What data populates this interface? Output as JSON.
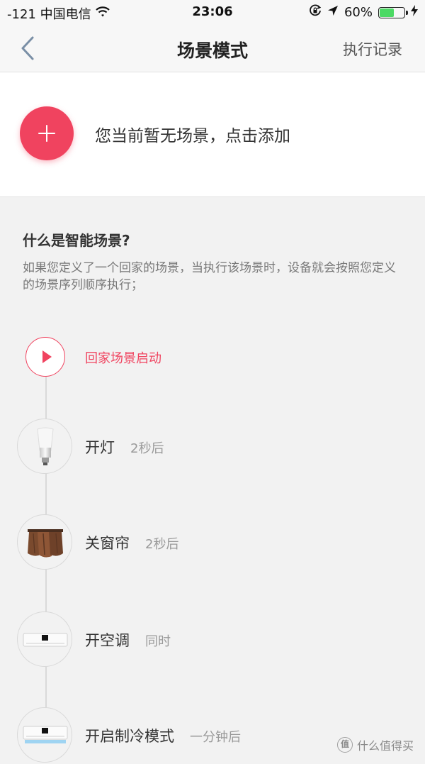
{
  "status_bar": {
    "carrier": "-121 中国电信",
    "time": "23:06",
    "battery_percent": "60%",
    "battery_level": 0.6,
    "battery_color": "#4cd964",
    "icons": [
      "wifi-icon",
      "rotation-lock-icon",
      "location-arrow-icon",
      "battery-icon",
      "charging-bolt-icon"
    ]
  },
  "nav": {
    "back_icon": "chevron-left-icon",
    "title": "场景模式",
    "action": "执行记录"
  },
  "empty_state": {
    "add_icon": "plus-icon",
    "text": "您当前暂无场景，点击添加"
  },
  "intro": {
    "title": "什么是智能场景?",
    "description": "如果您定义了一个回家的场景，当执行该场景时，设备就会按照您定义的场景序列顺序执行；"
  },
  "timeline": {
    "steps": [
      {
        "icon": "play-icon",
        "label": "回家场景启动",
        "delay": ""
      },
      {
        "icon": "light-bulb-icon",
        "label": "开灯",
        "delay": "2秒后"
      },
      {
        "icon": "curtain-icon",
        "label": "关窗帘",
        "delay": "2秒后"
      },
      {
        "icon": "air-conditioner-icon",
        "label": "开空调",
        "delay": "同时"
      },
      {
        "icon": "air-conditioner-cooling-icon",
        "label": "开启制冷模式",
        "delay": "一分钟后"
      }
    ]
  },
  "watermark": {
    "badge": "值",
    "text": "什么值得买"
  },
  "colors": {
    "accent": "#f0435f",
    "background": "#f2f2f2",
    "panel": "#ffffff",
    "nav_background": "#f7f7f7"
  }
}
